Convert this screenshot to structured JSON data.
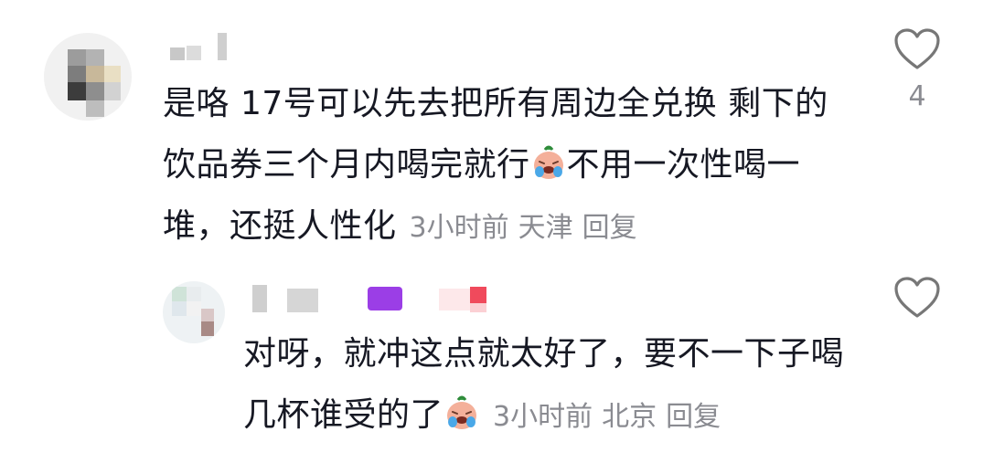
{
  "comments": [
    {
      "text": "是咯 17号可以先去把所有周边全兑换 剩下的饮品券三个月内喝完就行",
      "text_after_emoji": "不用一次性喝一堆，还挺人性化",
      "emoji_name": "crying-face-emoji",
      "time": "3小时前",
      "location": "天津",
      "reply_label": "回复",
      "like_count": "4"
    },
    {
      "text": "对呀，就冲这点就太好了，要不一下子喝几杯谁受的了",
      "emoji_name": "crying-face-emoji",
      "time": "3小时前",
      "location": "北京",
      "reply_label": "回复"
    }
  ]
}
